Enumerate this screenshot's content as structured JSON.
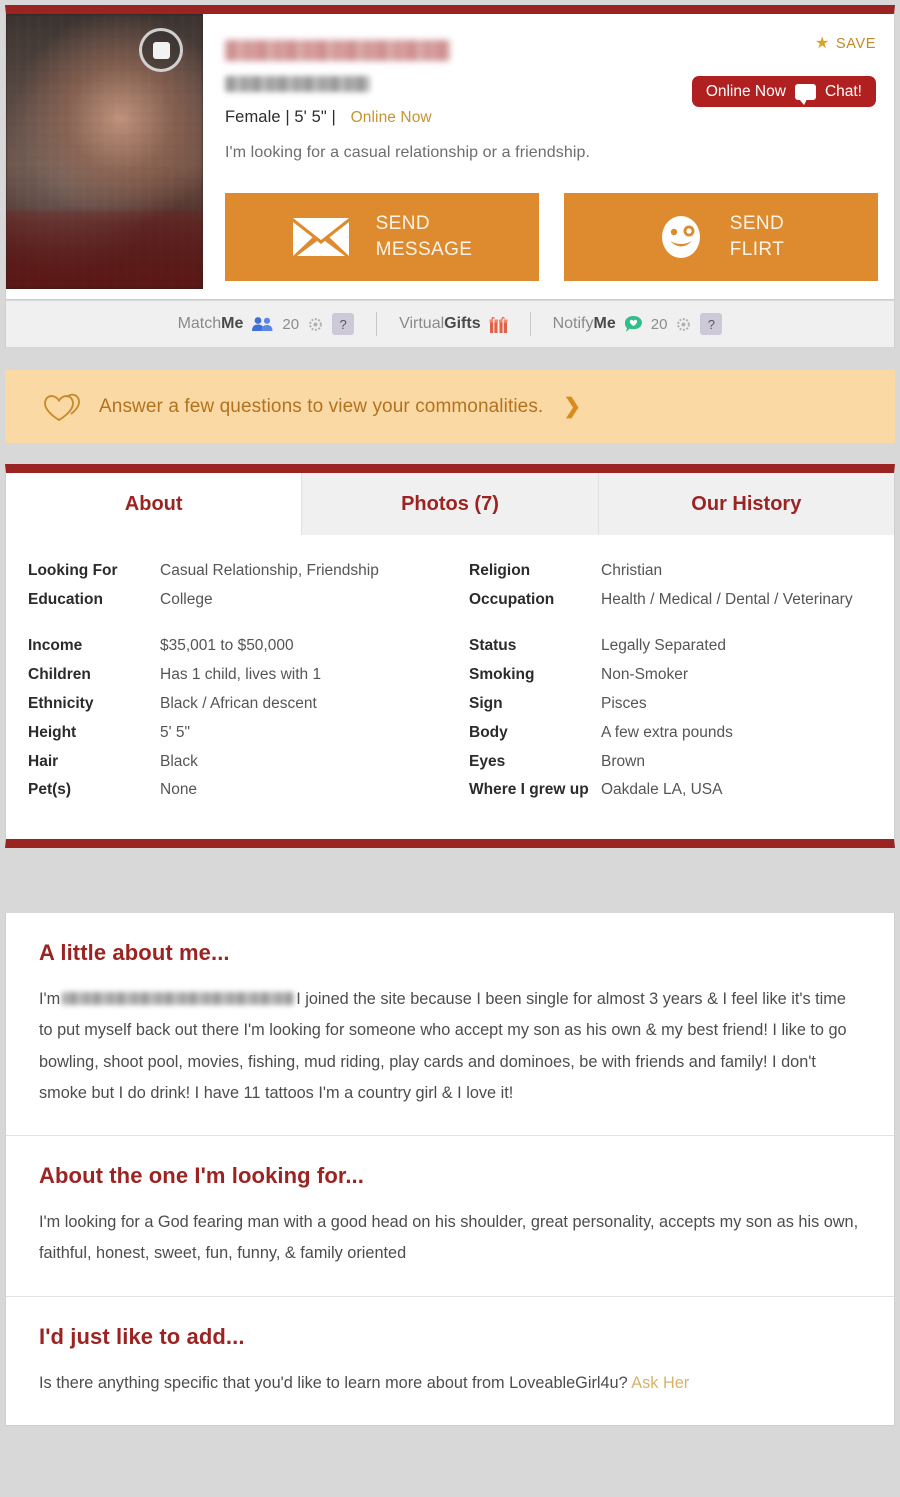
{
  "profile": {
    "username_redacted": true,
    "age_location_redacted": true,
    "gender": "Female",
    "height": "5' 5\"",
    "online_status": "Online Now",
    "tagline": "I'm looking for a casual relationship or a friendship.",
    "display_name_in_text": "LoveableGirl4u"
  },
  "header": {
    "save_label": "SAVE",
    "chat_badge_status": "Online Now",
    "chat_badge_action": "Chat!",
    "send_message_line1": "SEND",
    "send_message_line2": "MESSAGE",
    "send_flirt_line1": "SEND",
    "send_flirt_line2": "FLIRT"
  },
  "stats": [
    {
      "name_light": "Match",
      "name_bold": "Me",
      "count": "20",
      "help": "?"
    },
    {
      "name_light": "Virtual",
      "name_bold": "Gifts",
      "count": "",
      "help": ""
    },
    {
      "name_light": "Notify",
      "name_bold": "Me",
      "count": "20",
      "help": "?"
    }
  ],
  "commonalities": {
    "text": "Answer a few questions to view your commonalities.",
    "chevron": "❯"
  },
  "tabs": [
    {
      "label": "About",
      "active": true
    },
    {
      "label": "Photos (7)",
      "active": false
    },
    {
      "label": "Our History",
      "active": false
    }
  ],
  "details": {
    "left": [
      {
        "key": "Looking For",
        "value": "Casual Relationship, Friendship"
      },
      {
        "key": "Education",
        "value": "College"
      },
      {
        "key": "Income",
        "value": "$35,001 to $50,000"
      },
      {
        "key": "Children",
        "value": "Has 1 child, lives with 1"
      },
      {
        "key": "Ethnicity",
        "value": "Black / African descent"
      },
      {
        "key": "Height",
        "value": "5' 5\""
      },
      {
        "key": "Hair",
        "value": "Black"
      },
      {
        "key": "Pet(s)",
        "value": "None"
      }
    ],
    "right": [
      {
        "key": "Religion",
        "value": "Christian"
      },
      {
        "key": "Occupation",
        "value": "Health / Medical / Dental / Veterinary"
      },
      {
        "key": "Status",
        "value": "Legally Separated"
      },
      {
        "key": "Smoking",
        "value": "Non-Smoker"
      },
      {
        "key": "Sign",
        "value": "Pisces"
      },
      {
        "key": "Body",
        "value": "A few extra pounds"
      },
      {
        "key": "Eyes",
        "value": "Brown"
      },
      {
        "key": "Where I grew up",
        "value": "Oakdale LA, USA"
      }
    ]
  },
  "sections": {
    "about_me": {
      "title": "A little about me...",
      "prefix": "I'm",
      "body": "I joined the site because I been single for almost 3 years & I feel like it's time to put myself back out there I'm looking for someone who accept my son as his own & my best friend! I like to go bowling, shoot pool, movies, fishing, mud riding, play cards and dominoes, be with friends and family! I don't smoke but I do drink! I have 11 tattoos I'm a country girl & I love it!"
    },
    "looking_for": {
      "title": "About the one I'm looking for...",
      "body": "I'm looking for a God fearing man with a good head on his shoulder, great personality, accepts my son as his own, faithful, honest, sweet, fun, funny, & family oriented"
    },
    "add": {
      "title": "I'd just like to add...",
      "body": "Is there anything specific that you'd like to learn more about from LoveableGirl4u?",
      "link": "Ask Her"
    }
  },
  "colors": {
    "brand_red": "#9B2423",
    "accent_orange": "#DD8B2E",
    "banner_peach": "#FBD9A4",
    "chat_red": "#B02020",
    "link_gold": "#D7B36A"
  }
}
